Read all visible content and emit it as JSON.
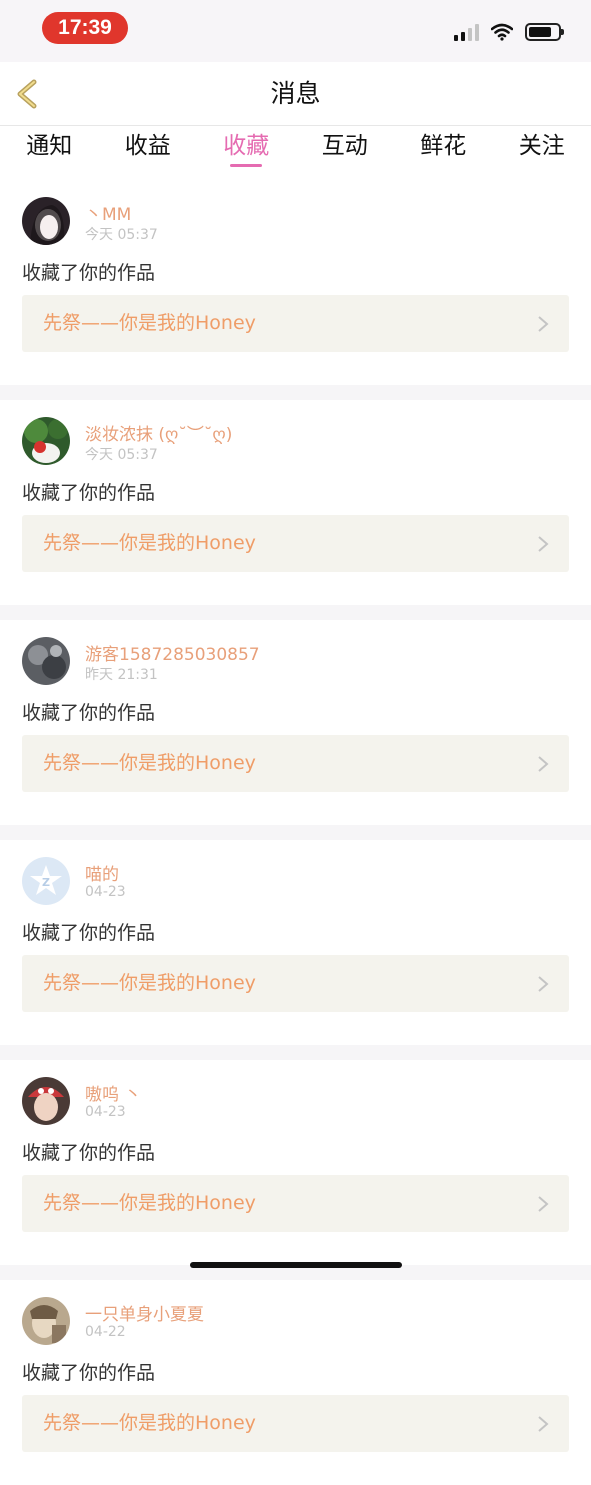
{
  "status_bar": {
    "time": "17:39",
    "battery_level": 0.8
  },
  "header": {
    "title": "消息",
    "back_icon": "chevron-left-icon"
  },
  "tabs": [
    {
      "label": "通知",
      "active": false
    },
    {
      "label": "收益",
      "active": false
    },
    {
      "label": "收藏",
      "active": true
    },
    {
      "label": "互动",
      "active": false
    },
    {
      "label": "鲜花",
      "active": false
    },
    {
      "label": "关注",
      "active": false
    }
  ],
  "colors": {
    "accent": "#e56bb1",
    "username": "#e8a07a",
    "link_text": "#ef9d68",
    "link_bg": "#f4f3ed",
    "time_pill": "#e0362c"
  },
  "notifications": [
    {
      "username": "丶MM",
      "time": "今天 05:37",
      "action": "收藏了你的作品",
      "work_title": "先祭——你是我的Honey"
    },
    {
      "username": "淡妆浓抹 (ღ˘︶˘ღ)",
      "time": "今天 05:37",
      "action": "收藏了你的作品",
      "work_title": "先祭——你是我的Honey"
    },
    {
      "username": "游客1587285030857",
      "time": "昨天 21:31",
      "action": "收藏了你的作品",
      "work_title": "先祭——你是我的Honey"
    },
    {
      "username": "喵的",
      "time": "04-23",
      "action": "收藏了你的作品",
      "work_title": "先祭——你是我的Honey"
    },
    {
      "username": "嗷呜 丶",
      "time": "04-23",
      "action": "收藏了你的作品",
      "work_title": "先祭——你是我的Honey"
    },
    {
      "username": "一只单身小夏夏",
      "time": "04-22",
      "action": "收藏了你的作品",
      "work_title": "先祭——你是我的Honey"
    }
  ]
}
